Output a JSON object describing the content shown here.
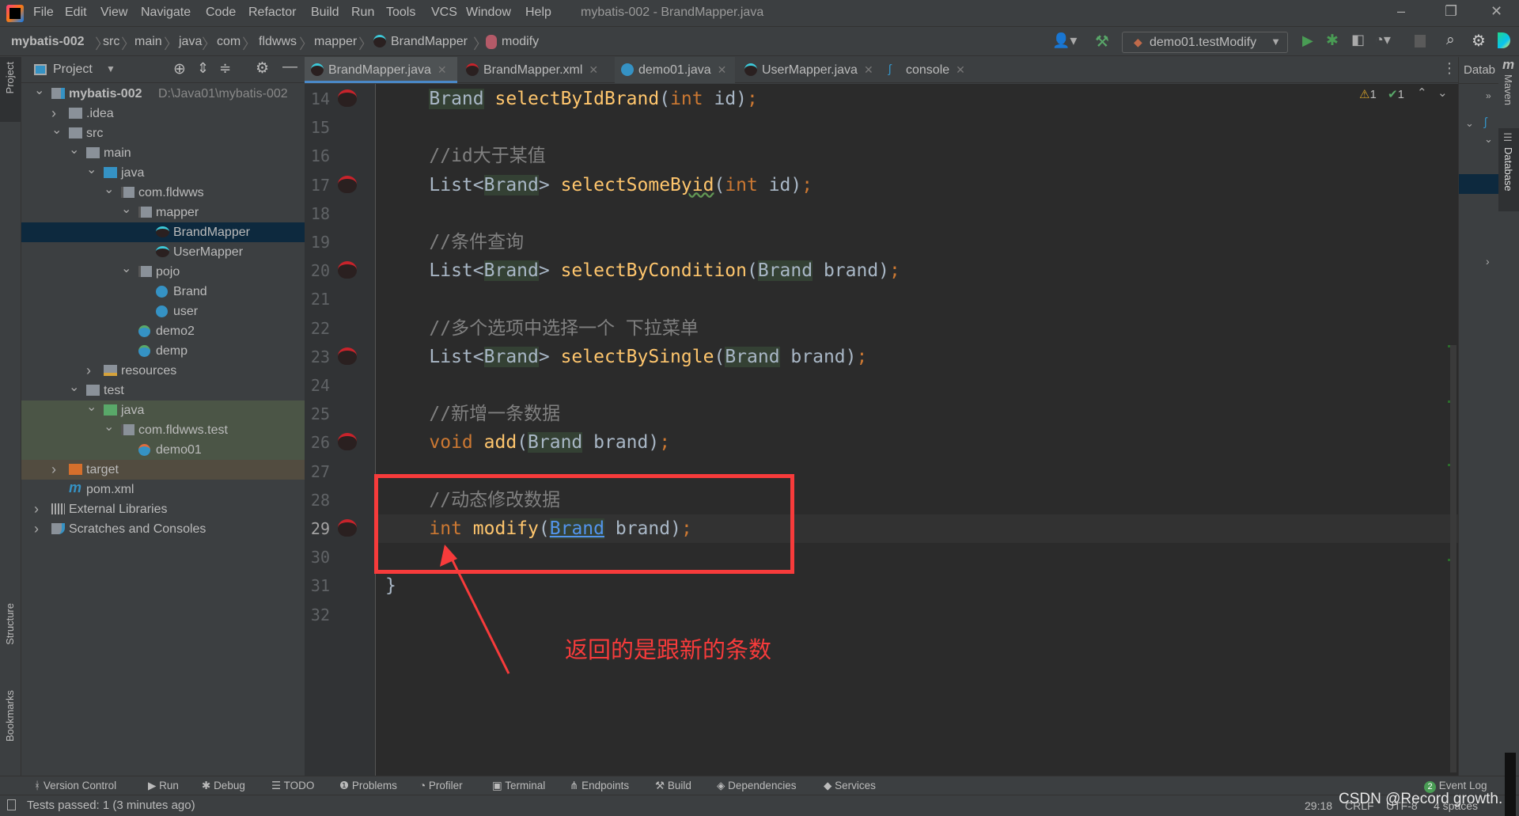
{
  "window": {
    "title": "mybatis-002 - BrandMapper.java",
    "menu": [
      "File",
      "Edit",
      "View",
      "Navigate",
      "Code",
      "Refactor",
      "Build",
      "Run",
      "Tools",
      "VCS",
      "Window",
      "Help"
    ]
  },
  "breadcrumb": [
    "mybatis-002",
    "src",
    "main",
    "java",
    "com",
    "fldwws",
    "mapper",
    "BrandMapper",
    "modify"
  ],
  "toolbar": {
    "run_config": "demo01.testModify"
  },
  "project_panel": {
    "title": "Project",
    "tree": [
      {
        "label": "mybatis-002",
        "path": "D:\\Java01\\mybatis-002",
        "level": 0,
        "chev": "v",
        "icon": "module",
        "bold": true
      },
      {
        "label": ".idea",
        "level": 1,
        "chev": ">",
        "icon": "folder"
      },
      {
        "label": "src",
        "level": 1,
        "chev": "v",
        "icon": "folder"
      },
      {
        "label": "main",
        "level": 2,
        "chev": "v",
        "icon": "folder"
      },
      {
        "label": "java",
        "level": 3,
        "chev": "v",
        "icon": "src"
      },
      {
        "label": "com.fldwws",
        "level": 4,
        "chev": "v",
        "icon": "pkg"
      },
      {
        "label": "mapper",
        "level": 5,
        "chev": "v",
        "icon": "pkg"
      },
      {
        "label": "BrandMapper",
        "level": 6,
        "icon": "mapper",
        "selected": true
      },
      {
        "label": "UserMapper",
        "level": 6,
        "icon": "mapper"
      },
      {
        "label": "pojo",
        "level": 5,
        "chev": "v",
        "icon": "pkg"
      },
      {
        "label": "Brand",
        "level": 6,
        "icon": "class"
      },
      {
        "label": "user",
        "level": 6,
        "icon": "class"
      },
      {
        "label": "demo2",
        "level": 5,
        "icon": "runclass"
      },
      {
        "label": "demp",
        "level": 5,
        "icon": "runclass"
      },
      {
        "label": "resources",
        "level": 3,
        "chev": ">",
        "icon": "res"
      },
      {
        "label": "test",
        "level": 2,
        "chev": "v",
        "icon": "folder"
      },
      {
        "label": "java",
        "level": 3,
        "chev": "v",
        "icon": "testsrc",
        "bg": "test"
      },
      {
        "label": "com.fldwws.test",
        "level": 4,
        "chev": "v",
        "icon": "pkg",
        "bg": "test"
      },
      {
        "label": "demo01",
        "level": 5,
        "icon": "testclass",
        "bg": "test"
      },
      {
        "label": "target",
        "level": 1,
        "chev": ">",
        "icon": "excluded",
        "bg": "target"
      },
      {
        "label": "pom.xml",
        "level": 1,
        "icon": "maven"
      },
      {
        "label": "External Libraries",
        "level": 0,
        "chev": ">",
        "icon": "libs"
      },
      {
        "label": "Scratches and Consoles",
        "level": 0,
        "chev": ">",
        "icon": "scratch"
      }
    ]
  },
  "tabs": [
    {
      "label": "BrandMapper.java",
      "icon": "mapper",
      "active": true
    },
    {
      "label": "BrandMapper.xml",
      "icon": "mapper-xml"
    },
    {
      "label": "demo01.java",
      "icon": "class"
    },
    {
      "label": "UserMapper.java",
      "icon": "mapper"
    },
    {
      "label": "console",
      "icon": "mysql"
    }
  ],
  "inspections": {
    "warnings": "1",
    "ok": "1"
  },
  "code": [
    {
      "n": "14",
      "m": true,
      "t": [
        [
          "    ",
          "pl"
        ],
        [
          "Brand",
          "hl"
        ],
        [
          " ",
          "pl"
        ],
        [
          "selectByIdBrand",
          "fn"
        ],
        [
          "(",
          "pl"
        ],
        [
          "int",
          "kw"
        ],
        [
          " id)",
          "pl"
        ],
        [
          ";",
          "kw"
        ]
      ]
    },
    {
      "n": "15",
      "t": []
    },
    {
      "n": "16",
      "t": [
        [
          "    //id大于某值",
          "cm"
        ]
      ]
    },
    {
      "n": "17",
      "m": true,
      "t": [
        [
          "    List<",
          "pl"
        ],
        [
          "Brand",
          "hl"
        ],
        [
          "> ",
          "pl"
        ],
        [
          "selectSomeB",
          "fn"
        ],
        [
          "yid",
          "fn wavy"
        ],
        [
          "(",
          "pl"
        ],
        [
          "int",
          "kw"
        ],
        [
          " id)",
          "pl"
        ],
        [
          ";",
          "kw"
        ]
      ]
    },
    {
      "n": "18",
      "t": []
    },
    {
      "n": "19",
      "t": [
        [
          "    //条件查询",
          "cm"
        ]
      ]
    },
    {
      "n": "20",
      "m": true,
      "t": [
        [
          "    List<",
          "pl"
        ],
        [
          "Brand",
          "hl"
        ],
        [
          "> ",
          "pl"
        ],
        [
          "selectByCondition",
          "fn"
        ],
        [
          "(",
          "pl"
        ],
        [
          "Brand",
          "hl"
        ],
        [
          " brand)",
          "pl"
        ],
        [
          ";",
          "kw"
        ]
      ]
    },
    {
      "n": "21",
      "t": []
    },
    {
      "n": "22",
      "t": [
        [
          "    //多个选项中选择一个 下拉菜单",
          "cm"
        ]
      ]
    },
    {
      "n": "23",
      "m": true,
      "t": [
        [
          "    List<",
          "pl"
        ],
        [
          "Brand",
          "hl"
        ],
        [
          "> ",
          "pl"
        ],
        [
          "selectBySingle",
          "fn"
        ],
        [
          "(",
          "pl"
        ],
        [
          "Brand",
          "hl"
        ],
        [
          " brand)",
          "pl"
        ],
        [
          ";",
          "kw"
        ]
      ]
    },
    {
      "n": "24",
      "t": []
    },
    {
      "n": "25",
      "t": [
        [
          "    //新增一条数据",
          "cm"
        ]
      ]
    },
    {
      "n": "26",
      "m": true,
      "t": [
        [
          "    ",
          "pl"
        ],
        [
          "void",
          "kw"
        ],
        [
          " ",
          "pl"
        ],
        [
          "add",
          "fn"
        ],
        [
          "(",
          "pl"
        ],
        [
          "Brand",
          "hl"
        ],
        [
          " brand)",
          "pl"
        ],
        [
          ";",
          "kw"
        ]
      ]
    },
    {
      "n": "27",
      "t": []
    },
    {
      "n": "28",
      "t": [
        [
          "    //动态修改数据",
          "cm"
        ]
      ]
    },
    {
      "n": "29",
      "m": true,
      "current": true,
      "t": [
        [
          "    ",
          "pl"
        ],
        [
          "int",
          "kw"
        ],
        [
          " ",
          "pl"
        ],
        [
          "modify",
          "fn"
        ],
        [
          "(",
          "pl"
        ],
        [
          "Brand",
          "sel"
        ],
        [
          " brand)",
          "pl"
        ],
        [
          ";",
          "kw"
        ]
      ]
    },
    {
      "n": "30",
      "t": []
    },
    {
      "n": "31",
      "t": [
        [
          "}",
          "pl"
        ]
      ]
    },
    {
      "n": "32",
      "t": []
    }
  ],
  "annotation": {
    "text": "返回的是跟新的条数",
    "color": "#f73b3b"
  },
  "right_panel": {
    "header": "Datab",
    "maven": "Maven",
    "database": "Database"
  },
  "left_strip": {
    "project": "Project",
    "structure": "Structure",
    "bookmarks": "Bookmarks"
  },
  "bottom_tools": [
    "Version Control",
    "Run",
    "Debug",
    "TODO",
    "Problems",
    "Profiler",
    "Terminal",
    "Endpoints",
    "Build",
    "Dependencies",
    "Services"
  ],
  "event_log": {
    "label": "Event Log",
    "count": "2"
  },
  "status": {
    "message": "Tests passed: 1 (3 minutes ago)",
    "position": "29:18",
    "line_sep": "CRLF",
    "encoding": "UTF-8",
    "indent": "4 spaces"
  },
  "watermark": "CSDN @Record growth."
}
